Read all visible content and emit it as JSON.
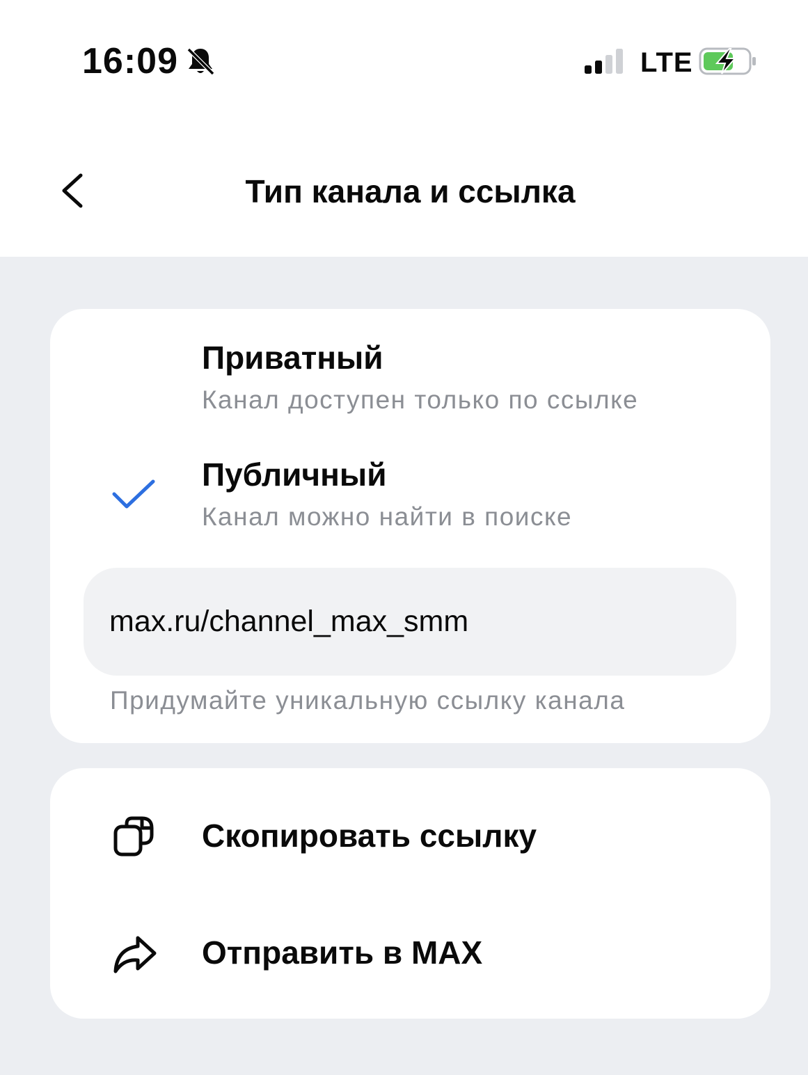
{
  "status_bar": {
    "time": "16:09",
    "network": "LTE",
    "icons": [
      "bell-muted-icon",
      "signal-icon",
      "battery-charging-icon"
    ]
  },
  "nav": {
    "back_icon": "chevron-left-icon",
    "title": "Тип канала и ссылка"
  },
  "channel_type": {
    "options": [
      {
        "title": "Приватный",
        "subtitle": "Канал доступен только по ссылке",
        "selected": false
      },
      {
        "title": "Публичный",
        "subtitle": "Канал можно найти в поиске",
        "selected": true
      }
    ],
    "link_value": "max.ru/channel_max_smm",
    "link_hint": "Придумайте уникальную ссылку канала"
  },
  "actions": [
    {
      "label": "Скопировать ссылку",
      "icon": "copy-icon"
    },
    {
      "label": "Отправить в MAX",
      "icon": "share-arrow-icon"
    }
  ],
  "colors": {
    "accent": "#2d6fe0",
    "background": "#eceef2",
    "card": "#ffffff",
    "secondary_text": "#8b8e94",
    "battery_green": "#5ec95a"
  }
}
